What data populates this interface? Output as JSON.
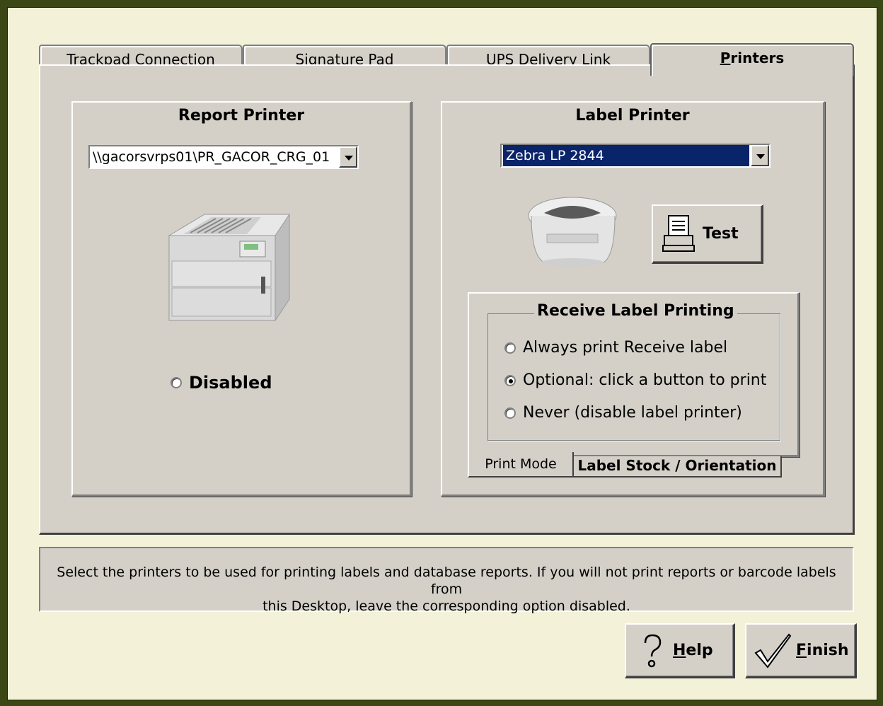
{
  "tabs": [
    {
      "label": "Trackpad Connection",
      "mnemonic": "T",
      "rest": "rackpad Connection",
      "active": false
    },
    {
      "label": "Signature Pad",
      "mnemonic": "S",
      "rest": "ignature Pad",
      "active": false
    },
    {
      "label": "UPS Delivery Link",
      "pre": "UPS ",
      "mnemonic": "D",
      "rest": "elivery Link",
      "active": false
    },
    {
      "label": "Printers",
      "mnemonic": "P",
      "rest": "rinters",
      "active": true
    }
  ],
  "report_printer": {
    "title": "Report Printer",
    "selected": "\\\\gacorsvrps01\\PR_GACOR_CRG_01",
    "disabled_label": "Disabled",
    "disabled_checked": false,
    "image": "laser-printer-icon"
  },
  "label_printer": {
    "title": "Label Printer",
    "selected": "Zebra LP 2844",
    "image": "label-printer-icon",
    "test_button": "Test",
    "receive_group_title": "Receive Label Printing",
    "options": [
      {
        "label": "Always print Receive label",
        "checked": false
      },
      {
        "label": "Optional: click a button to print",
        "checked": true
      },
      {
        "label": "Never (disable label printer)",
        "checked": false
      }
    ],
    "subtabs": [
      {
        "label": "Print Mode",
        "active": true
      },
      {
        "label": "Label Stock / Orientation",
        "active": false
      }
    ]
  },
  "info_text_line1": "Select the printers to be used for printing labels and database reports.  If you will not print reports or barcode labels from",
  "info_text_line2": "this Desktop, leave the corresponding option disabled.",
  "buttons": {
    "help": {
      "mnemonic": "H",
      "rest": "elp",
      "icon": "question-icon"
    },
    "finish": {
      "mnemonic": "F",
      "rest": "inish",
      "icon": "checkmark-icon"
    }
  },
  "colors": {
    "frame": "#3b4714",
    "window_bg": "#f3f1d8",
    "panel": "#d4d0c8",
    "selection": "#0a246a"
  }
}
